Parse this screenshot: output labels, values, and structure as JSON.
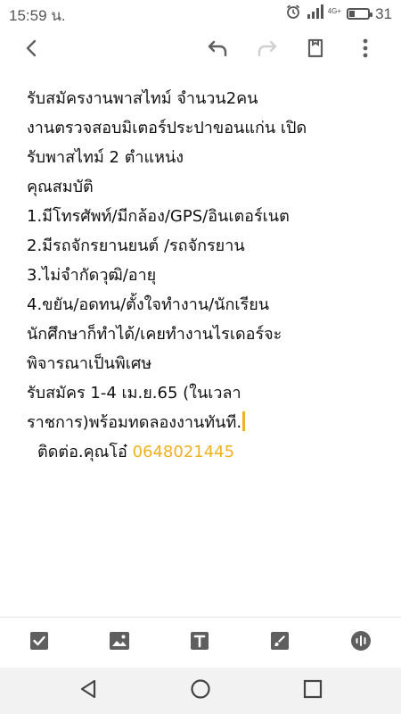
{
  "status_bar": {
    "time": "15:59 น.",
    "network_label": "4G+",
    "battery_percent": "31",
    "battery_level": 0.31
  },
  "toolbar": {
    "icons": [
      "back-arrow-icon",
      "undo-icon",
      "redo-icon",
      "label-icon",
      "more-vert-icon"
    ]
  },
  "note": {
    "lines": [
      "รับสมัครงานพาสไทม์ จำนวน2คน",
      "งานตรวจสอบมิเตอร์ประปาขอนแก่น เปิด",
      "รับพาสไทม์ 2 ตำแหน่ง",
      "คุณสมบัติ",
      "1.มีโทรศัพท์/มีกล้อง/GPS/อินเตอร์เนต",
      "2.มีรถจักรยานยนต์ /รถจักรยาน",
      "3.ไม่จำกัดวุฒิ/อายุ",
      "4.ขยัน/อดทน/ตั้งใจทำงาน/นักเรียน",
      "นักศึกษาก็ทำได้/เคยทำงานไรเดอร์จะ",
      "พิจารณาเป็นพิเศษ",
      "รับสมัคร 1-4 เม.ย.65 (ในเวลา",
      "ราชการ)พร้อมทดลองงานทันที."
    ],
    "contact_label": "ติดต่อ.คุณโอ๋",
    "contact_phone": "0648021445"
  },
  "format_bar": {
    "icons": [
      "checkbox-icon",
      "image-icon",
      "text-format-icon",
      "brush-icon",
      "voice-icon"
    ]
  },
  "nav_bar": {
    "icons": [
      "nav-back-icon",
      "nav-home-icon",
      "nav-recent-icon"
    ]
  },
  "colors": {
    "accent": "#f2b21f",
    "icon_gray": "#5f5f5f",
    "text": "#111111"
  }
}
